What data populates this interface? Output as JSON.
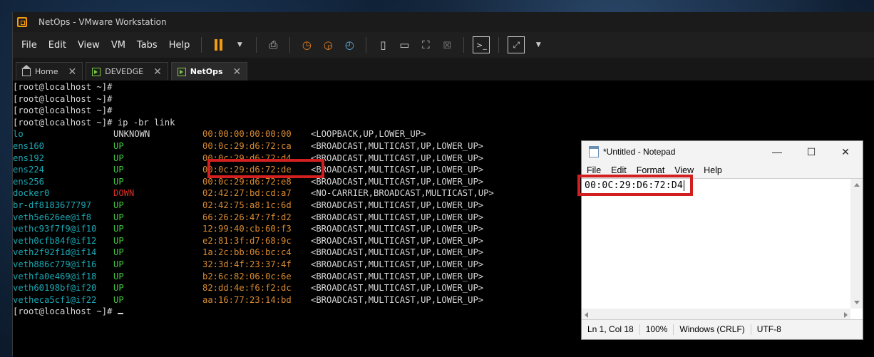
{
  "window": {
    "title": "NetOps - VMware Workstation"
  },
  "menu": [
    "File",
    "Edit",
    "View",
    "VM",
    "Tabs",
    "Help"
  ],
  "toolbar": {
    "icons": [
      "pause-icon",
      "dropdown-icon",
      "send-keys-icon",
      "snapshot-icon",
      "revert-snapshot-icon",
      "snapshot-manager-icon",
      "sidebar-icon",
      "console-view-icon",
      "fullscreen-icon",
      "unity-icon",
      "terminal-icon",
      "stretch-icon"
    ]
  },
  "tabs": [
    {
      "label": "Home",
      "active": false
    },
    {
      "label": "DEVEDGE",
      "active": false
    },
    {
      "label": "NetOps",
      "active": true
    }
  ],
  "terminal": {
    "prompts": [
      "[root@localhost ~]#",
      "[root@localhost ~]#",
      "[root@localhost ~]#"
    ],
    "command_line": "[root@localhost ~]# ip -br link",
    "interfaces": [
      {
        "name": "lo",
        "state": "UNKNOWN",
        "mac": "00:00:00:00:00:00",
        "flags": "<LOOPBACK,UP,LOWER_UP>"
      },
      {
        "name": "ens160",
        "state": "UP",
        "mac": "00:0c:29:d6:72:ca",
        "flags": "<BROADCAST,MULTICAST,UP,LOWER_UP>"
      },
      {
        "name": "ens192",
        "state": "UP",
        "mac": "00:0c:29:d6:72:d4",
        "flags": "<BROADCAST,MULTICAST,UP,LOWER_UP>"
      },
      {
        "name": "ens224",
        "state": "UP",
        "mac": "00:0c:29:d6:72:de",
        "flags": "<BROADCAST,MULTICAST,UP,LOWER_UP>"
      },
      {
        "name": "ens256",
        "state": "UP",
        "mac": "00:0c:29:d6:72:e8",
        "flags": "<BROADCAST,MULTICAST,UP,LOWER_UP>"
      },
      {
        "name": "docker0",
        "state": "DOWN",
        "mac": "02:42:27:bd:cd:a7",
        "flags": "<NO-CARRIER,BROADCAST,MULTICAST,UP>"
      },
      {
        "name": "br-df8183677797",
        "state": "UP",
        "mac": "02:42:75:a8:1c:6d",
        "flags": "<BROADCAST,MULTICAST,UP,LOWER_UP>"
      },
      {
        "name": "veth5e626ee@if8",
        "state": "UP",
        "mac": "66:26:26:47:7f:d2",
        "flags": "<BROADCAST,MULTICAST,UP,LOWER_UP>"
      },
      {
        "name": "vethc93f7f9@if10",
        "state": "UP",
        "mac": "12:99:40:cb:60:f3",
        "flags": "<BROADCAST,MULTICAST,UP,LOWER_UP>"
      },
      {
        "name": "veth0cfb84f@if12",
        "state": "UP",
        "mac": "e2:81:3f:d7:68:9c",
        "flags": "<BROADCAST,MULTICAST,UP,LOWER_UP>"
      },
      {
        "name": "veth2f92f1d@if14",
        "state": "UP",
        "mac": "1a:2c:bb:06:bc:c4",
        "flags": "<BROADCAST,MULTICAST,UP,LOWER_UP>"
      },
      {
        "name": "veth886c779@if16",
        "state": "UP",
        "mac": "32:3d:4f:23:37:4f",
        "flags": "<BROADCAST,MULTICAST,UP,LOWER_UP>"
      },
      {
        "name": "vethfa0e469@if18",
        "state": "UP",
        "mac": "b2:6c:82:06:0c:6e",
        "flags": "<BROADCAST,MULTICAST,UP,LOWER_UP>"
      },
      {
        "name": "veth60198bf@if20",
        "state": "UP",
        "mac": "82:dd:4e:f6:f2:dc",
        "flags": "<BROADCAST,MULTICAST,UP,LOWER_UP>"
      },
      {
        "name": "vetheca5cf1@if22",
        "state": "UP",
        "mac": "aa:16:77:23:14:bd",
        "flags": "<BROADCAST,MULTICAST,UP,LOWER_UP>"
      }
    ],
    "last_prompt": "[root@localhost ~]#"
  },
  "notepad": {
    "title": "*Untitled - Notepad",
    "menu": [
      "File",
      "Edit",
      "Format",
      "View",
      "Help"
    ],
    "content": "00:0C:29:D6:72:D4",
    "status": {
      "position": "Ln 1, Col 18",
      "zoom": "100%",
      "line_ending": "Windows (CRLF)",
      "encoding": "UTF-8"
    }
  },
  "colors": {
    "highlight": "#d21f1f",
    "iface_name": "#1aa9b5",
    "state_up": "#41c441",
    "state_down": "#d93026",
    "mac": "#d98a30"
  }
}
